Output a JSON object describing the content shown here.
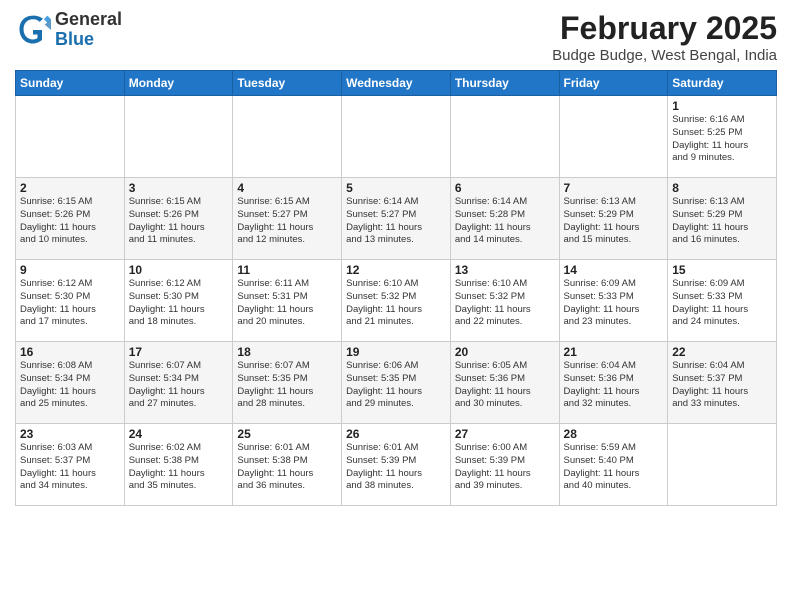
{
  "header": {
    "logo_general": "General",
    "logo_blue": "Blue",
    "month_title": "February 2025",
    "location": "Budge Budge, West Bengal, India"
  },
  "weekdays": [
    "Sunday",
    "Monday",
    "Tuesday",
    "Wednesday",
    "Thursday",
    "Friday",
    "Saturday"
  ],
  "weeks": [
    [
      {
        "day": "",
        "info": ""
      },
      {
        "day": "",
        "info": ""
      },
      {
        "day": "",
        "info": ""
      },
      {
        "day": "",
        "info": ""
      },
      {
        "day": "",
        "info": ""
      },
      {
        "day": "",
        "info": ""
      },
      {
        "day": "1",
        "info": "Sunrise: 6:16 AM\nSunset: 5:25 PM\nDaylight: 11 hours\nand 9 minutes."
      }
    ],
    [
      {
        "day": "2",
        "info": "Sunrise: 6:15 AM\nSunset: 5:26 PM\nDaylight: 11 hours\nand 10 minutes."
      },
      {
        "day": "3",
        "info": "Sunrise: 6:15 AM\nSunset: 5:26 PM\nDaylight: 11 hours\nand 11 minutes."
      },
      {
        "day": "4",
        "info": "Sunrise: 6:15 AM\nSunset: 5:27 PM\nDaylight: 11 hours\nand 12 minutes."
      },
      {
        "day": "5",
        "info": "Sunrise: 6:14 AM\nSunset: 5:27 PM\nDaylight: 11 hours\nand 13 minutes."
      },
      {
        "day": "6",
        "info": "Sunrise: 6:14 AM\nSunset: 5:28 PM\nDaylight: 11 hours\nand 14 minutes."
      },
      {
        "day": "7",
        "info": "Sunrise: 6:13 AM\nSunset: 5:29 PM\nDaylight: 11 hours\nand 15 minutes."
      },
      {
        "day": "8",
        "info": "Sunrise: 6:13 AM\nSunset: 5:29 PM\nDaylight: 11 hours\nand 16 minutes."
      }
    ],
    [
      {
        "day": "9",
        "info": "Sunrise: 6:12 AM\nSunset: 5:30 PM\nDaylight: 11 hours\nand 17 minutes."
      },
      {
        "day": "10",
        "info": "Sunrise: 6:12 AM\nSunset: 5:30 PM\nDaylight: 11 hours\nand 18 minutes."
      },
      {
        "day": "11",
        "info": "Sunrise: 6:11 AM\nSunset: 5:31 PM\nDaylight: 11 hours\nand 20 minutes."
      },
      {
        "day": "12",
        "info": "Sunrise: 6:10 AM\nSunset: 5:32 PM\nDaylight: 11 hours\nand 21 minutes."
      },
      {
        "day": "13",
        "info": "Sunrise: 6:10 AM\nSunset: 5:32 PM\nDaylight: 11 hours\nand 22 minutes."
      },
      {
        "day": "14",
        "info": "Sunrise: 6:09 AM\nSunset: 5:33 PM\nDaylight: 11 hours\nand 23 minutes."
      },
      {
        "day": "15",
        "info": "Sunrise: 6:09 AM\nSunset: 5:33 PM\nDaylight: 11 hours\nand 24 minutes."
      }
    ],
    [
      {
        "day": "16",
        "info": "Sunrise: 6:08 AM\nSunset: 5:34 PM\nDaylight: 11 hours\nand 25 minutes."
      },
      {
        "day": "17",
        "info": "Sunrise: 6:07 AM\nSunset: 5:34 PM\nDaylight: 11 hours\nand 27 minutes."
      },
      {
        "day": "18",
        "info": "Sunrise: 6:07 AM\nSunset: 5:35 PM\nDaylight: 11 hours\nand 28 minutes."
      },
      {
        "day": "19",
        "info": "Sunrise: 6:06 AM\nSunset: 5:35 PM\nDaylight: 11 hours\nand 29 minutes."
      },
      {
        "day": "20",
        "info": "Sunrise: 6:05 AM\nSunset: 5:36 PM\nDaylight: 11 hours\nand 30 minutes."
      },
      {
        "day": "21",
        "info": "Sunrise: 6:04 AM\nSunset: 5:36 PM\nDaylight: 11 hours\nand 32 minutes."
      },
      {
        "day": "22",
        "info": "Sunrise: 6:04 AM\nSunset: 5:37 PM\nDaylight: 11 hours\nand 33 minutes."
      }
    ],
    [
      {
        "day": "23",
        "info": "Sunrise: 6:03 AM\nSunset: 5:37 PM\nDaylight: 11 hours\nand 34 minutes."
      },
      {
        "day": "24",
        "info": "Sunrise: 6:02 AM\nSunset: 5:38 PM\nDaylight: 11 hours\nand 35 minutes."
      },
      {
        "day": "25",
        "info": "Sunrise: 6:01 AM\nSunset: 5:38 PM\nDaylight: 11 hours\nand 36 minutes."
      },
      {
        "day": "26",
        "info": "Sunrise: 6:01 AM\nSunset: 5:39 PM\nDaylight: 11 hours\nand 38 minutes."
      },
      {
        "day": "27",
        "info": "Sunrise: 6:00 AM\nSunset: 5:39 PM\nDaylight: 11 hours\nand 39 minutes."
      },
      {
        "day": "28",
        "info": "Sunrise: 5:59 AM\nSunset: 5:40 PM\nDaylight: 11 hours\nand 40 minutes."
      },
      {
        "day": "",
        "info": ""
      }
    ]
  ]
}
